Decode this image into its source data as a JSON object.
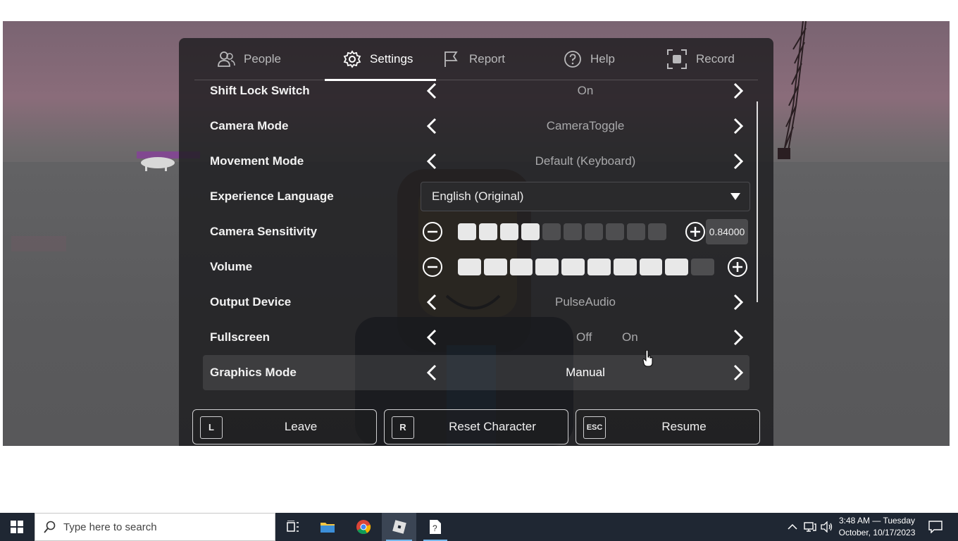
{
  "tabs": [
    {
      "label": "People",
      "icon": "people-icon"
    },
    {
      "label": "Settings",
      "icon": "gear-icon"
    },
    {
      "label": "Report",
      "icon": "flag-icon"
    },
    {
      "label": "Help",
      "icon": "question-icon"
    },
    {
      "label": "Record",
      "icon": "record-icon"
    }
  ],
  "active_tab": "Settings",
  "settings": {
    "shift_lock": {
      "label": "Shift Lock Switch",
      "value": "On"
    },
    "camera_mode": {
      "label": "Camera Mode",
      "value": "CameraToggle"
    },
    "movement_mode": {
      "label": "Movement Mode",
      "value": "Default (Keyboard)"
    },
    "language": {
      "label": "Experience Language",
      "value": "English (Original)"
    },
    "camera_sensitivity": {
      "label": "Camera Sensitivity",
      "value_text": "0.84000",
      "filled_segments": 4,
      "total_segments": 10
    },
    "volume": {
      "label": "Volume",
      "filled_segments": 9,
      "total_segments": 10
    },
    "output_device": {
      "label": "Output Device",
      "value": "PulseAudio"
    },
    "fullscreen": {
      "label": "Fullscreen",
      "off_label": "Off",
      "on_label": "On"
    },
    "graphics_mode": {
      "label": "Graphics Mode",
      "value": "Manual"
    }
  },
  "buttons": {
    "leave": {
      "key": "L",
      "label": "Leave"
    },
    "reset": {
      "key": "R",
      "label": "Reset Character"
    },
    "resume": {
      "key": "ESC",
      "label": "Resume"
    }
  },
  "taskbar": {
    "search_placeholder": "Type here to search",
    "time": "3:48 AM — Tuesday",
    "date": "October, 10/17/2023"
  },
  "colors": {
    "menu_bg": "#1c1c1e",
    "accent_white": "#ffffff",
    "taskbar_bg": "#1f2733",
    "taskbar_active": "#76b9ed"
  }
}
